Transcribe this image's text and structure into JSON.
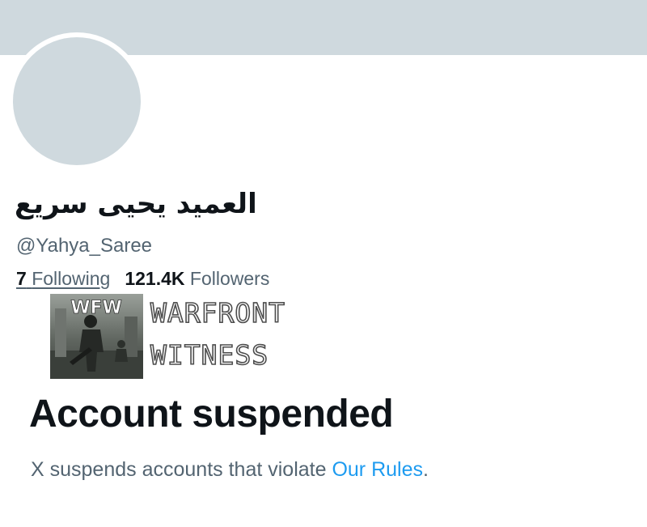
{
  "profile": {
    "display_name": "العميد يحيى سريع",
    "handle": "@Yahya_Saree"
  },
  "stats": {
    "following_count": "7",
    "following_label": "Following",
    "followers_count": "121.4K",
    "followers_label": "Followers"
  },
  "watermark": {
    "badge": "WFW",
    "line1": "WARFRONT",
    "line2": "WITNESS"
  },
  "suspension": {
    "title": "Account suspended",
    "description_prefix": "X suspends accounts that violate ",
    "rules_link": "Our Rules",
    "description_suffix": "."
  },
  "colors": {
    "banner": "#cfd9de",
    "avatar": "#cfd9de",
    "text_primary": "#0f1419",
    "text_secondary": "#536471",
    "link": "#1d9bf0"
  }
}
